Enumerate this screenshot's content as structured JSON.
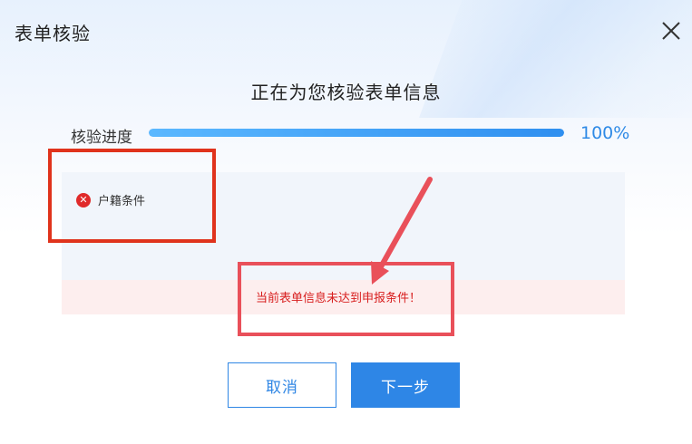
{
  "dialog": {
    "title": "表单核验",
    "close_icon": "close-icon"
  },
  "headline": "正在为您核验表单信息",
  "progress": {
    "label": "核验进度",
    "value": 100,
    "percent_text": "100%"
  },
  "check_items": [
    {
      "label": "户籍条件",
      "status": "failed",
      "icon": "error-x-icon"
    }
  ],
  "error_message": "当前表单信息未达到申报条件！",
  "buttons": {
    "cancel_label": "取消",
    "next_label": "下一步"
  },
  "colors": {
    "accent": "#2e86e6",
    "error": "#e02a2a",
    "annotation": "#e0331c"
  }
}
